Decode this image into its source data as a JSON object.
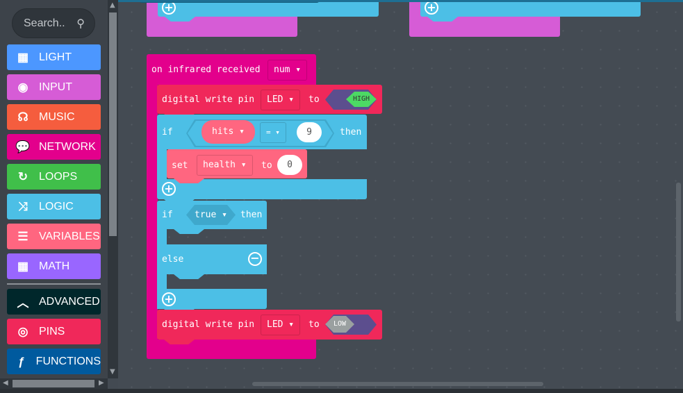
{
  "sidebar": {
    "search_placeholder": "Search..",
    "categories": [
      {
        "label": "LIGHT",
        "icon": "grid-icon",
        "color": "#4c97ff"
      },
      {
        "label": "INPUT",
        "icon": "target-icon",
        "color": "#d65cd6"
      },
      {
        "label": "MUSIC",
        "icon": "headphones-icon",
        "color": "#f55d3e"
      },
      {
        "label": "NETWORK",
        "icon": "chat-icon",
        "color": "#e3008c"
      },
      {
        "label": "LOOPS",
        "icon": "refresh-icon",
        "color": "#40bf4a"
      },
      {
        "label": "LOGIC",
        "icon": "shuffle-icon",
        "color": "#4cbfe6"
      },
      {
        "label": "VARIABLES",
        "icon": "list-icon",
        "color": "#ff6680"
      },
      {
        "label": "MATH",
        "icon": "calculator-icon",
        "color": "#9966ff"
      }
    ],
    "advanced": [
      {
        "label": "ADVANCED",
        "icon": "chevron-up-icon",
        "color": "#00272b"
      },
      {
        "label": "PINS",
        "icon": "rings-icon",
        "color": "#f0285a"
      },
      {
        "label": "FUNCTIONS",
        "icon": "function-icon",
        "color": "#005a9e"
      }
    ]
  },
  "blocks": {
    "event": {
      "label": "on infrared received",
      "dropdown": "num ▾"
    },
    "write1": {
      "label": "digital write pin",
      "pin": "LED ▾",
      "to": "to",
      "value": "HIGH"
    },
    "if1": {
      "if": "if",
      "var": "hits ▾",
      "op": "= ▾",
      "num": "9",
      "then": "then"
    },
    "set": {
      "label": "set",
      "var": "health ▾",
      "to": "to",
      "value": "0"
    },
    "if2": {
      "if": "if",
      "cond": "true ▾",
      "then": "then",
      "else": "else"
    },
    "write2": {
      "label": "digital write pin",
      "pin": "LED ▾",
      "to": "to",
      "value": "LOW"
    }
  },
  "colors": {
    "event": "#e3008c",
    "pins": "#f0285a",
    "logic": "#4cbfe6",
    "variables": "#ff6680",
    "input": "#d65cd6"
  }
}
